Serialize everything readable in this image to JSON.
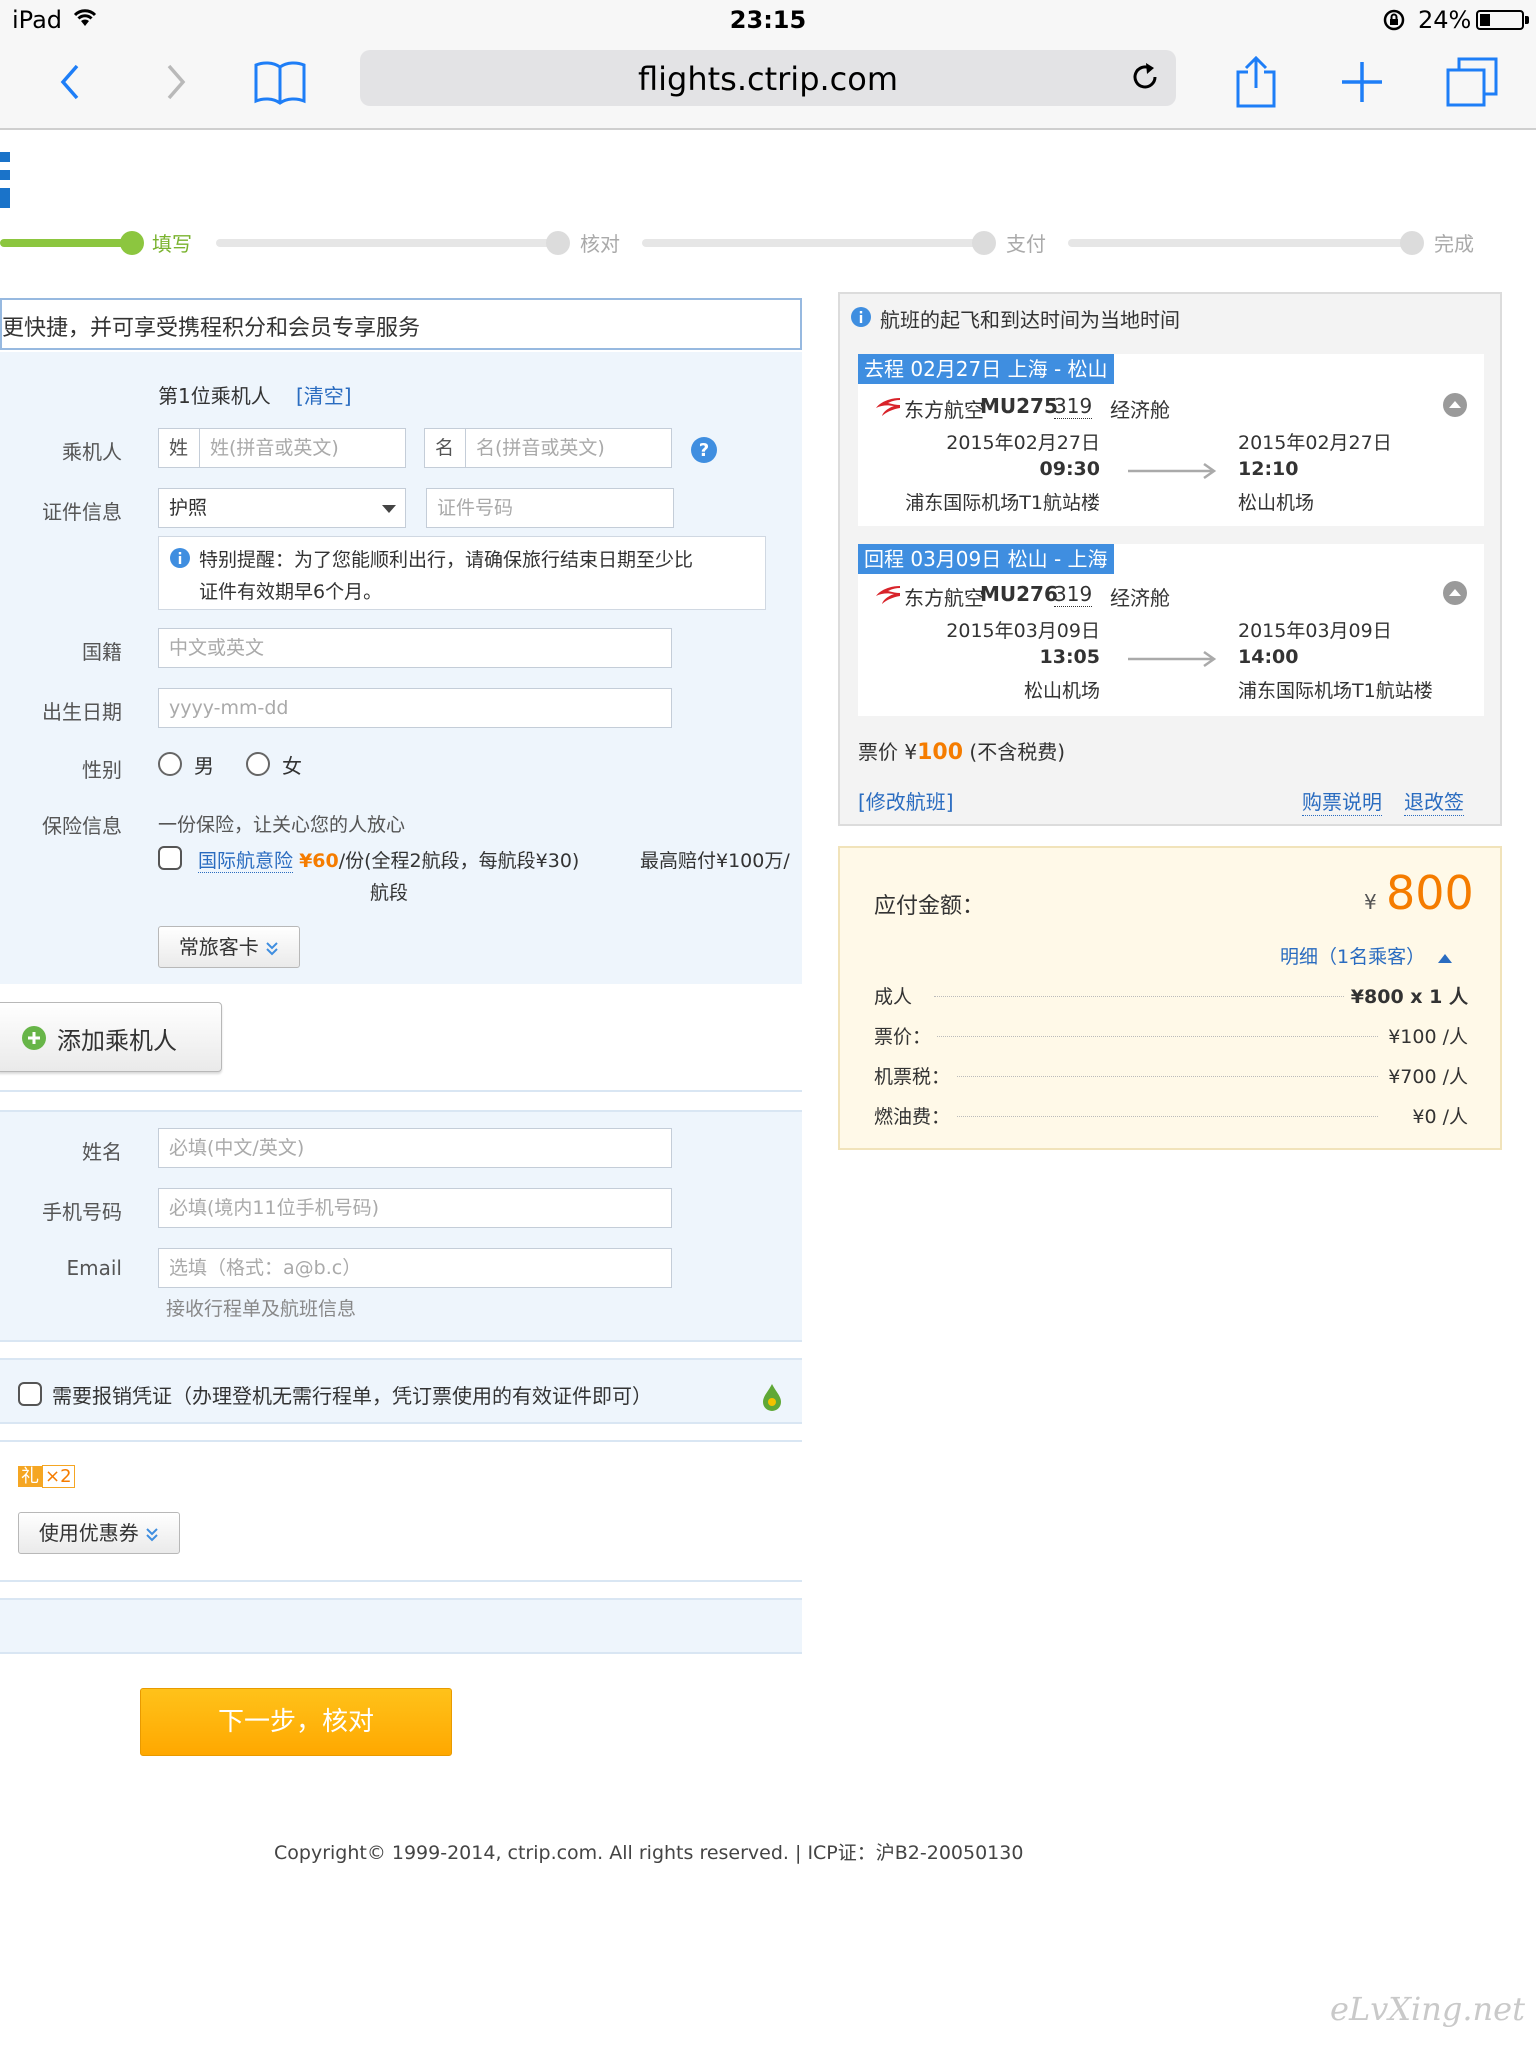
{
  "status_bar": {
    "device": "iPad",
    "time": "23:15",
    "battery": "24%",
    "battery_level": 0.24
  },
  "browser": {
    "url": "flights.ctrip.com"
  },
  "steps": [
    "填写",
    "核对",
    "支付",
    "完成"
  ],
  "login_tip": "更快捷，并可享受携程积分和会员专享服务",
  "passenger": {
    "heading": "第1位乘机人",
    "clear_link": "[清空]",
    "name_label": "乘机人",
    "surname_prefix": "姓",
    "surname_placeholder": "姓(拼音或英文)",
    "given_prefix": "名",
    "given_placeholder": "名(拼音或英文)",
    "id_label": "证件信息",
    "id_type": "护照",
    "id_number_placeholder": "证件号码",
    "id_notice_line1": "特别提醒：为了您能顺利出行，请确保旅行结束日期至少比",
    "id_notice_line2": "证件有效期早6个月。",
    "nationality_label": "国籍",
    "nationality_placeholder": "中文或英文",
    "birth_label": "出生日期",
    "birth_placeholder": "yyyy-mm-dd",
    "gender_label": "性别",
    "gender_male": "男",
    "gender_female": "女",
    "insurance_label": "保险信息",
    "insurance_slogan": "一份保险，让关心您的人放心",
    "insurance_name": "国际航意险",
    "insurance_price": "¥60",
    "insurance_detail": "/份(全程2航段，每航段¥30)",
    "insurance_max_line1": "最高赔付¥100万/",
    "insurance_max_line2": "航段",
    "frequent_flyer_button": "常旅客卡",
    "add_passenger_button": "添加乘机人"
  },
  "contact": {
    "name_label": "姓名",
    "name_placeholder": "必填(中文/英文)",
    "phone_label": "手机号码",
    "phone_placeholder": "必填(境内11位手机号码)",
    "email_label": "Email",
    "email_placeholder": "选填（格式：a@b.c）",
    "email_hint": "接收行程单及航班信息"
  },
  "invoice_checkbox_label": "需要报销凭证（办理登机无需行程单，凭订票使用的有效证件即可）",
  "coupon": {
    "gift_char": "礼",
    "gift_count": "×2",
    "button": "使用优惠券"
  },
  "next_button": "下一步，核对",
  "footer": "Copyright© 1999-2014, ctrip.com. All rights reserved. | ICP证：沪B2-20050130",
  "flight_panel": {
    "notice": "航班的起飞和到达时间为当地时间",
    "outbound": {
      "tag": "去程 02月27日 上海 - 松山",
      "airline": "东方航空",
      "flight_no": "MU275",
      "aircraft": "319",
      "cabin": "经济舱",
      "dep_date": "2015年02月27日",
      "dep_time": "09:30",
      "dep_airport": "浦东国际机场T1航站楼",
      "arr_date": "2015年02月27日",
      "arr_time": "12:10",
      "arr_airport": "松山机场"
    },
    "return": {
      "tag": "回程 03月09日 松山 - 上海",
      "airline": "东方航空",
      "flight_no": "MU276",
      "aircraft": "319",
      "cabin": "经济舱",
      "dep_date": "2015年03月09日",
      "dep_time": "13:05",
      "dep_airport": "松山机场",
      "arr_date": "2015年03月09日",
      "arr_time": "14:00",
      "arr_airport": "浦东国际机场T1航站楼"
    },
    "fare_prefix": "票价 ¥",
    "fare_value": "100",
    "fare_suffix": "(不含税费)",
    "modify_link": "[修改航班]",
    "purchase_note_link": "购票说明",
    "refund_link": "退改签"
  },
  "price": {
    "label": "应付金额：",
    "currency": "¥",
    "total": "800",
    "detail_link": "明细（1名乘客）",
    "rows": [
      {
        "k": "成人",
        "v": "¥800 x 1 人"
      },
      {
        "k": "票价：",
        "v": "¥100 /人"
      },
      {
        "k": "机票税：",
        "v": "¥700 /人"
      },
      {
        "k": "燃油费：",
        "v": "¥0 /人"
      }
    ]
  },
  "watermark": "eLvXing.net",
  "colors": {
    "accent_green": "#8cc63f",
    "link_blue": "#2a6cc0",
    "price_orange": "#f57c00",
    "button_orange": "#ffb400",
    "route_blue": "#3f8ee0"
  }
}
